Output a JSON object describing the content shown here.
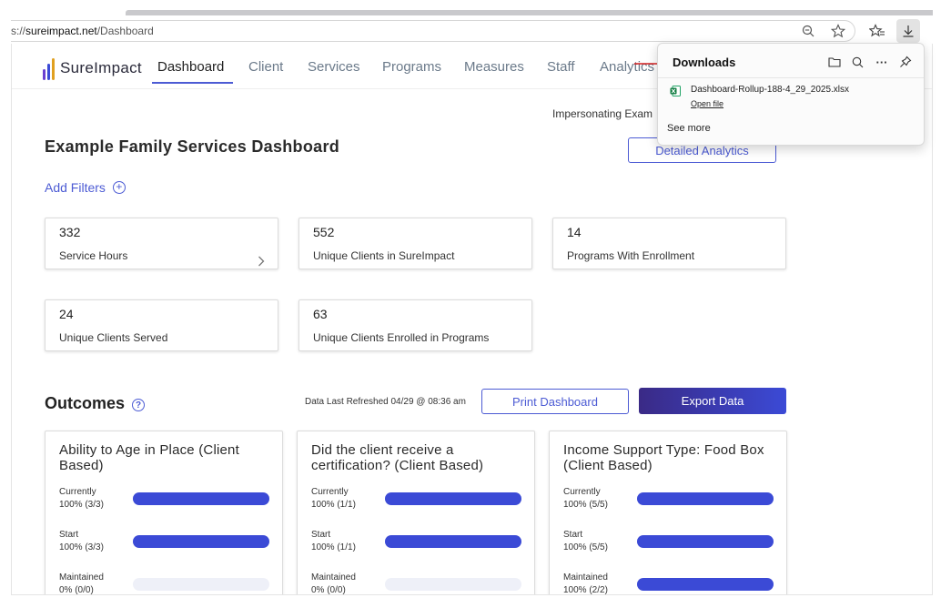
{
  "browser": {
    "url_prefix": "s://",
    "url_domain": "sureimpact.net",
    "url_path": "/Dashboard",
    "icons": [
      "zoom-out-icon",
      "star-icon",
      "favorites-icon",
      "download-icon"
    ]
  },
  "app": {
    "logo_text": "SureImpact",
    "nav": [
      "Dashboard",
      "Client",
      "Services",
      "Programs",
      "Measures",
      "Staff",
      "Analytics"
    ],
    "active_nav": "Dashboard"
  },
  "page": {
    "impersonating": "Impersonating Exam",
    "title": "Example Family Services Dashboard",
    "detailed_analytics": "Detailed Analytics",
    "add_filters": "Add Filters",
    "stats": [
      {
        "value": "332",
        "label": "Service Hours"
      },
      {
        "value": "552",
        "label": "Unique Clients in SureImpact"
      },
      {
        "value": "14",
        "label": "Programs With Enrollment"
      },
      {
        "value": "24",
        "label": "Unique Clients Served"
      },
      {
        "value": "63",
        "label": "Unique Clients Enrolled in Programs"
      }
    ]
  },
  "outcomes": {
    "title": "Outcomes",
    "refreshed": "Data Last Refreshed 04/29 @ 08:36 am",
    "print_label": "Print Dashboard",
    "export_label": "Export Data",
    "cards": [
      {
        "title": "Ability to Age in Place (Client Based)",
        "rows": [
          {
            "label": "Currently",
            "value": "100% (3/3)",
            "pct": 100
          },
          {
            "label": "Start",
            "value": "100% (3/3)",
            "pct": 100
          },
          {
            "label": "Maintained",
            "value": "0% (0/0)",
            "pct": 0
          }
        ]
      },
      {
        "title": "Did the client receive a certification? (Client Based)",
        "rows": [
          {
            "label": "Currently",
            "value": "100% (1/1)",
            "pct": 100
          },
          {
            "label": "Start",
            "value": "100% (1/1)",
            "pct": 100
          },
          {
            "label": "Maintained",
            "value": "0% (0/0)",
            "pct": 0
          }
        ]
      },
      {
        "title": "Income Support Type: Food Box (Client Based)",
        "rows": [
          {
            "label": "Currently",
            "value": "100% (5/5)",
            "pct": 100
          },
          {
            "label": "Start",
            "value": "100% (5/5)",
            "pct": 100
          },
          {
            "label": "Maintained",
            "value": "100% (2/2)",
            "pct": 100
          }
        ]
      }
    ]
  },
  "downloads": {
    "title": "Downloads",
    "file_name": "Dashboard-Rollup-188-4_29_2025.xlsx",
    "open_file": "Open file",
    "see_more": "See more"
  },
  "colors": {
    "accent": "#4c5bd4",
    "bar_fill": "#3b4ad6",
    "bar_track": "#eef0f8",
    "annotation_arrow": "#d62020"
  }
}
